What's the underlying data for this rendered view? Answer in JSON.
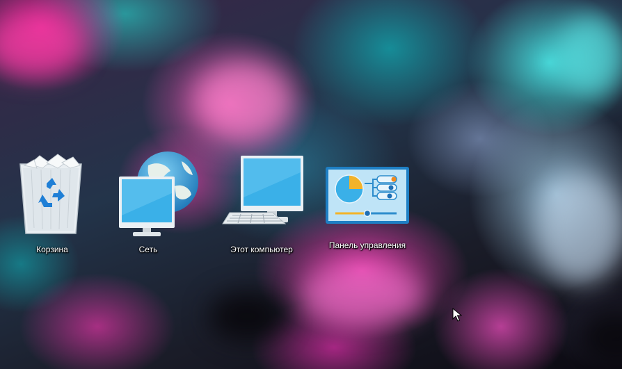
{
  "desktop": {
    "icons": [
      {
        "label": "Корзина",
        "icon": "recycle-bin-icon"
      },
      {
        "label": "Сеть",
        "icon": "network-icon"
      },
      {
        "label": "Этот компьютер",
        "icon": "this-pc-icon"
      },
      {
        "label": "Панель управления",
        "icon": "control-panel-icon"
      }
    ]
  },
  "colors": {
    "monitor_screen": "#3ab0e8",
    "label_text": "#ffffff",
    "accent_orange": "#f0a020"
  }
}
